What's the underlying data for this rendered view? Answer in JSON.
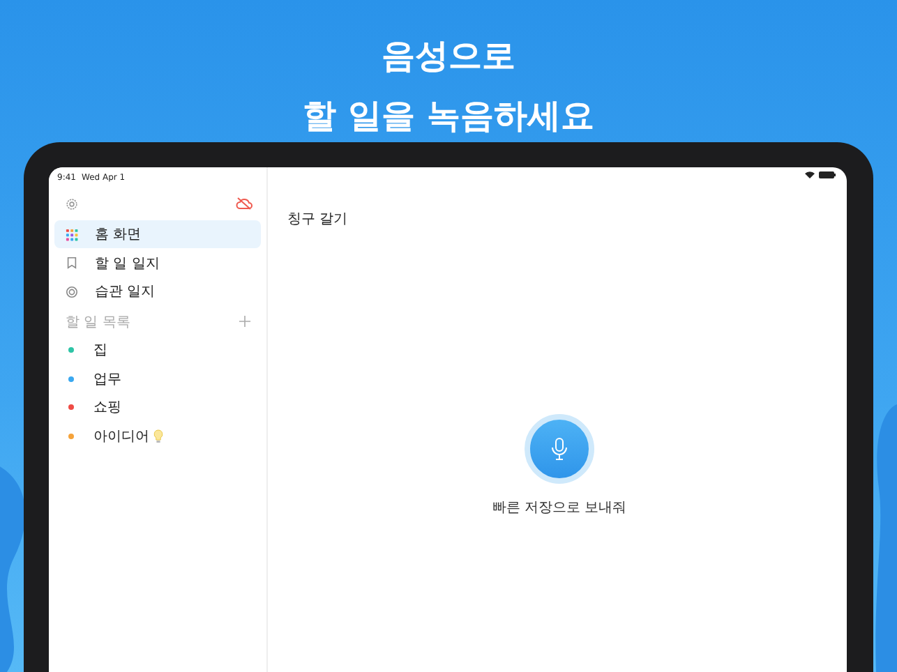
{
  "headline": [
    "음성으로",
    "할 일을 녹음하세요"
  ],
  "status_bar": {
    "time": "9:41",
    "date": "Wed Apr 1"
  },
  "sidebar": {
    "nav": [
      {
        "label": "홈 화면",
        "selected": true
      },
      {
        "label": "할 일 일지",
        "selected": false
      },
      {
        "label": "습관 일지",
        "selected": false
      }
    ],
    "section_title": "할 일 목록",
    "lists": [
      {
        "label": "집",
        "color": "#2ec4a6"
      },
      {
        "label": "업무",
        "color": "#3aa8f0"
      },
      {
        "label": "쇼핑",
        "color": "#ef4b45"
      },
      {
        "label": "아이디어",
        "color": "#f5a33b"
      }
    ]
  },
  "main": {
    "title": "칭구 갈기",
    "mic_caption": "빠른 저장으로 보내줘"
  }
}
